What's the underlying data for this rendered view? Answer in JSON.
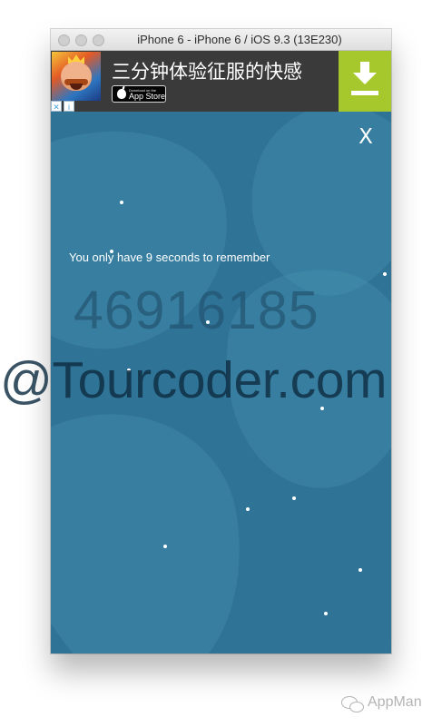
{
  "window": {
    "title": "iPhone 6 - iPhone 6 / iOS 9.3 (13E230)"
  },
  "ad": {
    "title": "三分钟体验征服的快感",
    "appstore_small": "Download on the",
    "appstore_big": "App Store",
    "close_mark": "✕",
    "info_mark": "i",
    "download_icon": "download-arrow-icon",
    "logo_icon": "game-character-logo-icon",
    "brand_color": "#a6c82d"
  },
  "game": {
    "close_label": "X",
    "prompt": "You only have 9 seconds to remember",
    "number": "46916185",
    "background_color": "#2f7397",
    "star_color": "#ffffff"
  },
  "watermark": {
    "text": "@Tourcoder.com"
  },
  "footer": {
    "label": "AppMan",
    "icon": "wechat-icon"
  }
}
